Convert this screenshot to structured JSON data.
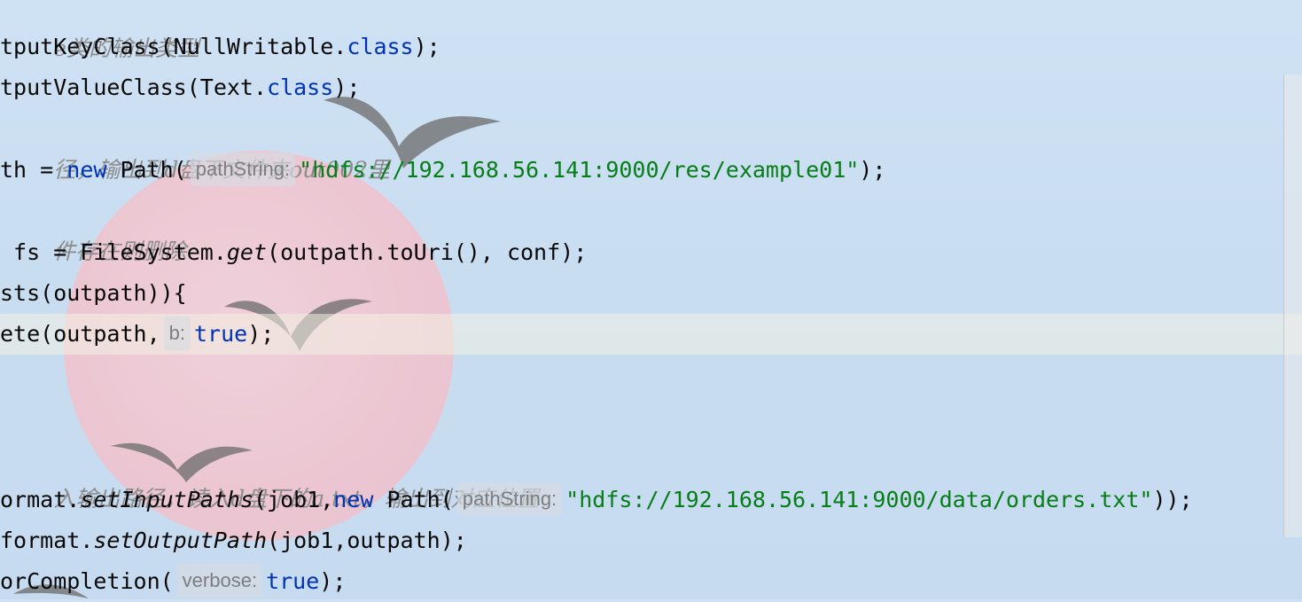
{
  "editor": {
    "lines": [
      {
        "comment": "e类的输出类型"
      },
      {
        "call": "tputKeyClass(NullWritable.",
        "kw": "class",
        "tail": ");"
      },
      {
        "call": "tputValueClass(Text.",
        "kw": "class",
        "tail": ");"
      },
      {
        "comment": "径，输出到d盘下文件夹out002里"
      },
      {
        "lead": "th = ",
        "kw": "new",
        "call": " Path(",
        "hint": "pathString:",
        "str": "\"hdfs://192.168.56.141:9000/res/example01\"",
        "tail": ");"
      },
      {
        "comment": "件存在则删除"
      },
      {
        "lead": " fs = FileSystem.",
        "method": "get",
        "tail": "(outpath.toUri(), conf);"
      },
      {
        "text": "sts(outpath)){"
      },
      {
        "call": "ete(outpath,",
        "hint": "b:",
        "kw": "true",
        "tail": ");"
      },
      {
        "comment": "入输出路径，读入d盘下的a.txt，输出到对应位置"
      },
      {
        "lead": "ormat.",
        "method": "setInputPaths",
        "call": "(job1,",
        "kw": "new",
        "call2": " Path(",
        "hint": "pathString:",
        "str": "\"hdfs://192.168.56.141:9000/data/orders.txt\"",
        "tail": "));"
      },
      {
        "lead": "format.",
        "method": "setOutputPath",
        "tail": "(job1,outpath);"
      },
      {
        "call": "orCompletion(",
        "hint": "verbose:",
        "kw": "true",
        "tail": ");"
      }
    ]
  },
  "colors": {
    "keyword": "#0033b3",
    "string": "#067d17",
    "comment": "#8c8c8c",
    "code": "#080808",
    "hint_text": "#7d7d7d"
  },
  "decor": {
    "icons": [
      "pink-circle-wallpaper",
      "bird-silhouette-icon"
    ]
  }
}
